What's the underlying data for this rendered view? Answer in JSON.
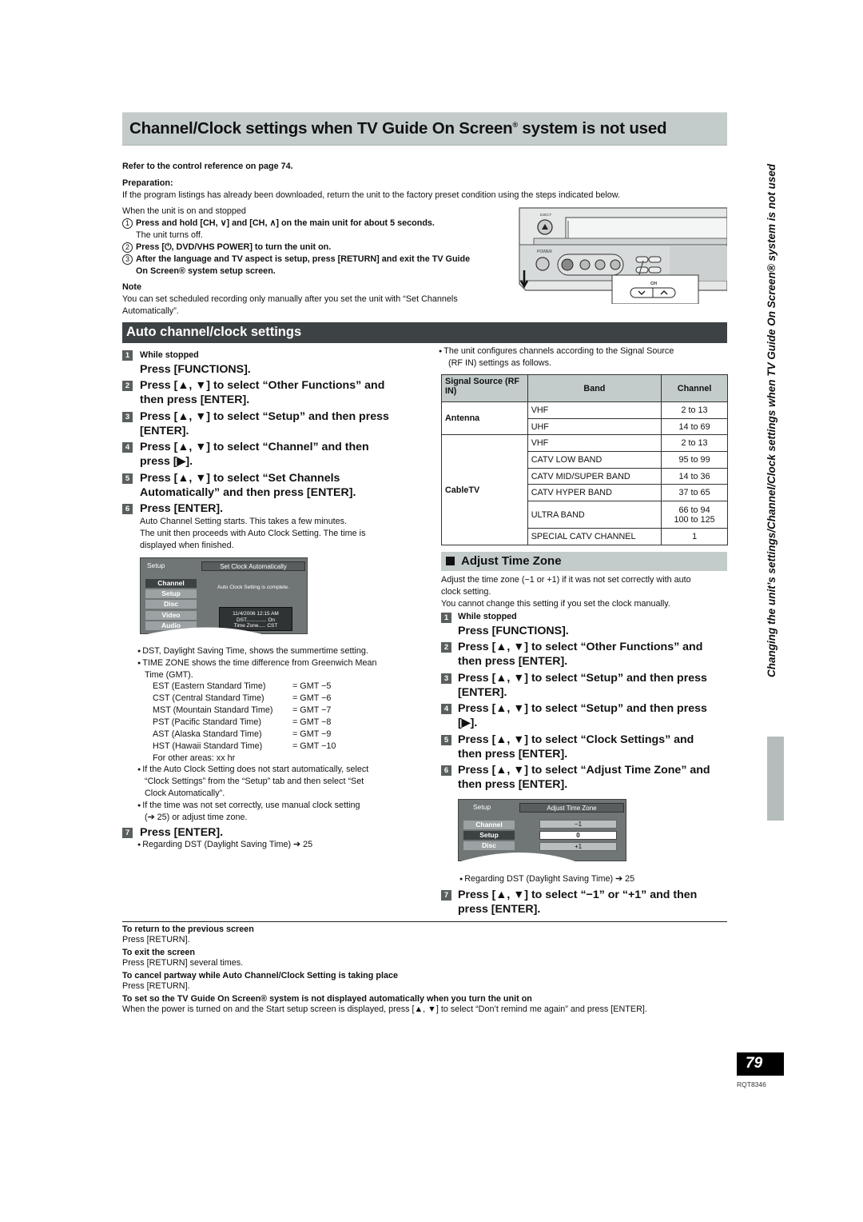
{
  "page_title": {
    "main": "Channel/Clock settings when TV Guide On Screen",
    "reg": "®",
    "rest": " system is not used"
  },
  "refer": "Refer to the control reference on page 74.",
  "preparation": {
    "heading": "Preparation:",
    "text": "If the program listings has already been downloaded, return the unit to the factory preset condition using the steps indicated below.",
    "condition": "When the unit is on and stopped",
    "steps": [
      {
        "n": "1",
        "text": "Press and hold [CH, ∨] and [CH, ∧] on the main unit for about 5 seconds.",
        "sub": "The unit turns off."
      },
      {
        "n": "2",
        "text": "Press [⏻, DVD/VHS POWER] to turn the unit on."
      },
      {
        "n": "3",
        "text": "After the language and TV aspect is setup, press [RETURN] and exit the TV Guide",
        "text2": "On Screen® system setup screen."
      }
    ]
  },
  "note": {
    "heading": "Note",
    "text": "You can set scheduled recording only manually after you set the unit with “Set Channels Automatically”."
  },
  "device_illustration": {
    "labels": {
      "eject": "EJECT",
      "power": "POWER",
      "ch": "CH"
    }
  },
  "auto_section": {
    "title": "Auto channel/clock settings",
    "steps": [
      {
        "n": "1",
        "pre": "While stopped",
        "text": "Press [FUNCTIONS]."
      },
      {
        "n": "2",
        "text": "Press [▲, ▼] to select “Other Functions” and",
        "text2": "then press [ENTER]."
      },
      {
        "n": "3",
        "text": "Press [▲, ▼] to select “Setup” and then press",
        "text2": "[ENTER]."
      },
      {
        "n": "4",
        "text": "Press [▲, ▼] to select “Channel” and then",
        "text2": "press [▶]."
      },
      {
        "n": "5",
        "text": "Press [▲, ▼] to select “Set Channels",
        "text2": "Automatically” and then press [ENTER]."
      },
      {
        "n": "6",
        "text": "Press [ENTER].",
        "desc": [
          "Auto Channel Setting starts. This takes a few minutes.",
          "The unit then proceeds with Auto Clock Setting. The time is",
          "displayed when finished."
        ]
      },
      {
        "n": "7",
        "text": "Press [ENTER].",
        "bullet": "Regarding DST (Daylight Saving Time) ➔ 25"
      }
    ],
    "osd": {
      "left_title": "Setup",
      "menu": [
        "Channel",
        "Setup",
        "Disc",
        "Video",
        "Audio"
      ],
      "selected": "Channel",
      "right_title": "Set Clock Automatically",
      "message": "Auto Clock Setting is complete.",
      "info": [
        "11/4/2006 12:15 AM",
        "DST.............. On",
        "Time Zone..... CST"
      ]
    },
    "bullets": [
      "DST, Daylight Saving Time, shows the summertime setting.",
      "TIME ZONE shows the time difference from Greenwich Mean",
      "Time (GMT)."
    ],
    "timezones": [
      {
        "name": "EST (Eastern Standard Time)",
        "eq": "= GMT −5"
      },
      {
        "name": "CST (Central Standard Time)",
        "eq": "= GMT −6"
      },
      {
        "name": "MST (Mountain Standard Time)",
        "eq": "= GMT −7"
      },
      {
        "name": "PST (Pacific Standard Time)",
        "eq": "= GMT −8"
      },
      {
        "name": "AST (Alaska Standard Time)",
        "eq": "= GMT −9"
      },
      {
        "name": "HST (Hawaii Standard Time)",
        "eq": "= GMT −10"
      }
    ],
    "other_areas": "For other areas: xx hr",
    "bullets2": [
      [
        "If the Auto Clock Setting does not start automatically, select",
        "“Clock Settings” from the “Setup” tab and then select “Set",
        "Clock Automatically”."
      ],
      [
        "If the time was not set correctly, use manual clock setting",
        "(➔ 25) or adjust time zone."
      ]
    ]
  },
  "channel_table": {
    "intro": [
      "The unit configures channels according to the Signal Source",
      "(RF IN) settings as follows."
    ],
    "headers": [
      "Signal Source (RF IN)",
      "Band",
      "Channel"
    ],
    "groups": [
      {
        "source": "Antenna",
        "rows": [
          [
            "VHF",
            "2 to 13"
          ],
          [
            "UHF",
            "14 to 69"
          ]
        ]
      },
      {
        "source": "CableTV",
        "rows": [
          [
            "VHF",
            "2 to 13"
          ],
          [
            "CATV LOW BAND",
            "95 to 99"
          ],
          [
            "CATV MID/SUPER BAND",
            "14 to 36"
          ],
          [
            "CATV HYPER BAND",
            "37 to 65"
          ],
          [
            "ULTRA BAND",
            "66 to 94 / 100 to 125"
          ],
          [
            "SPECIAL CATV CHANNEL",
            "1"
          ]
        ]
      }
    ]
  },
  "adjust_section": {
    "title": "Adjust Time Zone",
    "intro": [
      "Adjust the time zone (−1 or +1) if it was not set correctly with auto",
      "clock setting.",
      "You cannot change this setting if you set the clock manually."
    ],
    "steps": [
      {
        "n": "1",
        "pre": "While stopped",
        "text": "Press [FUNCTIONS]."
      },
      {
        "n": "2",
        "text": "Press [▲, ▼] to select “Other Functions” and",
        "text2": "then press [ENTER]."
      },
      {
        "n": "3",
        "text": "Press [▲, ▼] to select “Setup” and then press",
        "text2": "[ENTER]."
      },
      {
        "n": "4",
        "text": "Press [▲, ▼] to select “Setup” and then press",
        "text2": "[▶]."
      },
      {
        "n": "5",
        "text": "Press [▲, ▼] to select “Clock Settings” and",
        "text2": "then press [ENTER]."
      },
      {
        "n": "6",
        "text": "Press [▲, ▼] to select “Adjust Time Zone” and",
        "text2": "then press [ENTER]."
      },
      {
        "n": "7",
        "text": "Press [▲, ▼] to select “−1” or “+1” and then",
        "text2": "press [ENTER]."
      }
    ],
    "osd": {
      "left_title": "Setup",
      "menu": [
        "Channel",
        "Setup",
        "Disc"
      ],
      "selected": "Setup",
      "right_title": "Adjust Time Zone",
      "options": [
        "−1",
        "0",
        "+1"
      ],
      "current": "0"
    },
    "bullet": "Regarding DST (Daylight Saving Time) ➔ 25"
  },
  "footer": [
    {
      "heading": "To return to the previous screen",
      "text": "Press [RETURN]."
    },
    {
      "heading": "To exit the screen",
      "text": "Press [RETURN] several times."
    },
    {
      "heading": "To cancel partway while Auto Channel/Clock Setting is taking place",
      "text": "Press [RETURN]."
    },
    {
      "heading": "To set so the TV Guide On Screen® system is not displayed automatically when you turn the unit on",
      "text": "When the power is turned on and the Start setup screen is displayed, press [▲, ▼] to select “Don’t remind me again” and press [ENTER]."
    }
  ],
  "side_caption": "Changing the unit’s settings/Channel/Clock settings when TV Guide On Screen® system is not used",
  "page_number": "79",
  "doc_code": "RQT8346"
}
